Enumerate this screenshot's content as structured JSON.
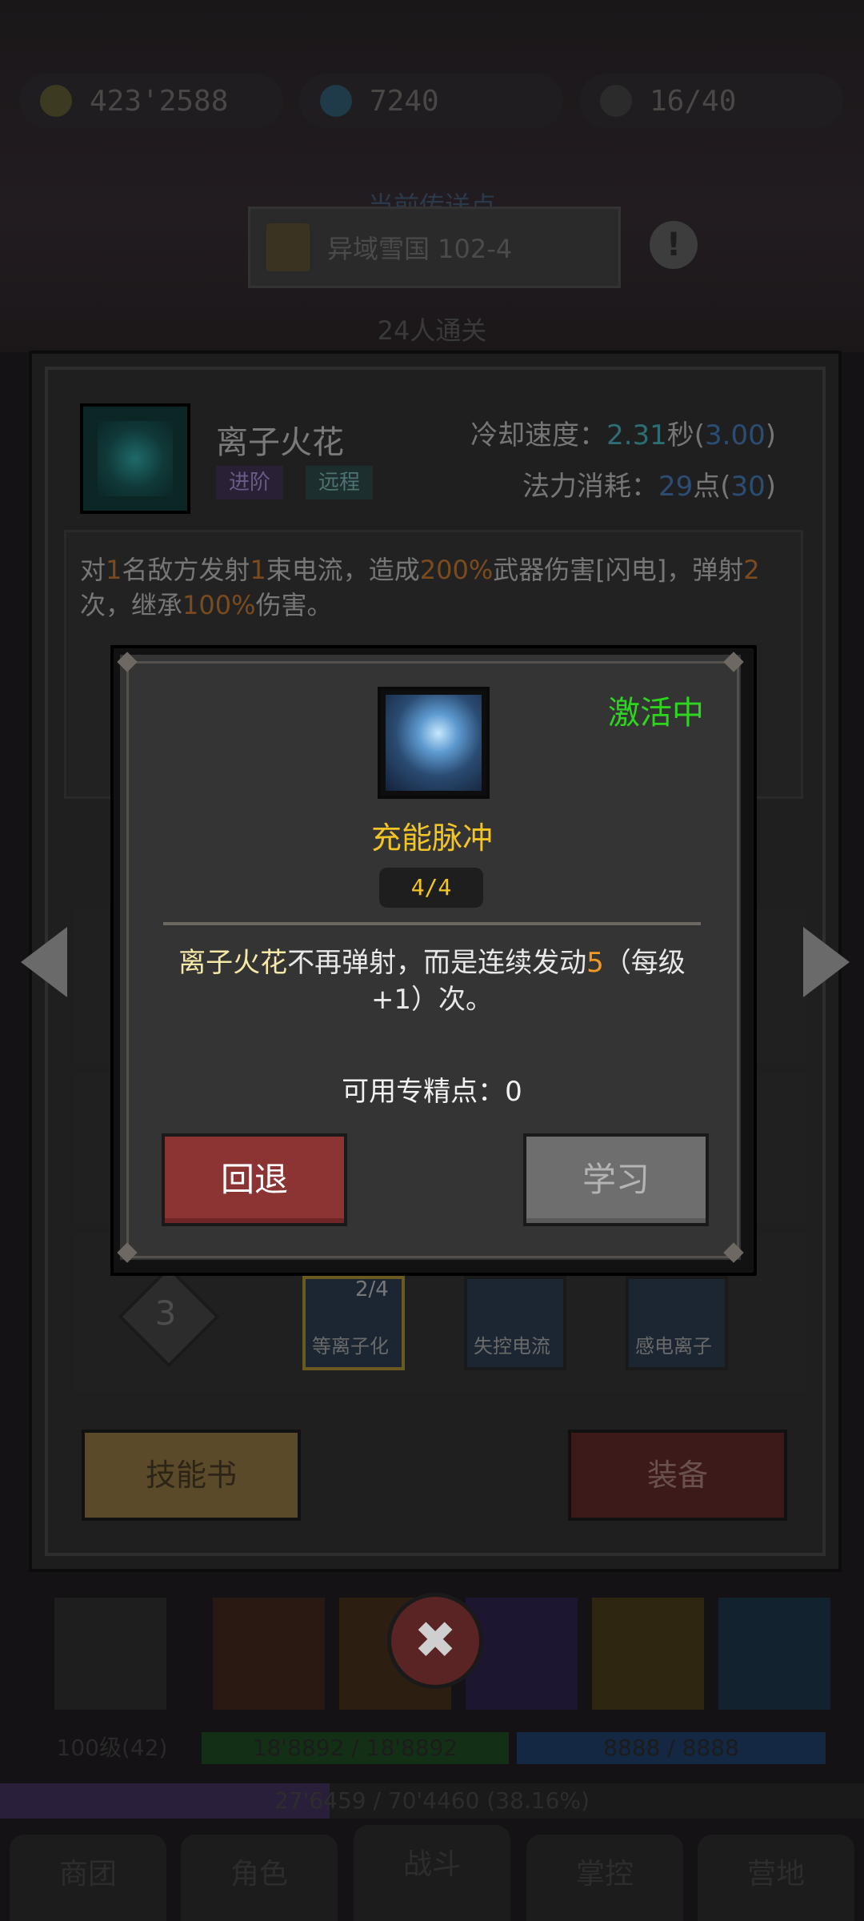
{
  "resources": {
    "gold": "423'2588",
    "gems": "7240",
    "keys": "16/40"
  },
  "portal": {
    "label": "当前传送点",
    "location": "异域雪国 102-4"
  },
  "cleared_label": "24人通关",
  "skill": {
    "name": "离子火花",
    "tags": [
      "进阶",
      "远程"
    ],
    "cooldown_label": "冷却速度：",
    "cooldown_value": "2.31",
    "cooldown_unit": "秒(",
    "cooldown_base": "3.00",
    "close_paren": ")",
    "mana_label": "法力消耗：",
    "mana_value": "29",
    "mana_unit": "点(",
    "mana_base": "30",
    "desc": {
      "p1": "对",
      "n1": "1",
      "p2": "名敌方发射",
      "n2": "1",
      "p3": "束电流，造成",
      "n3": "200%",
      "p4": "武器伤害[闪电]，弹射",
      "n4": "2",
      "p5": "次，继承",
      "n5": "100%",
      "p6": "伤害。"
    }
  },
  "talent_row": {
    "level": "3",
    "items": [
      {
        "name": "等离子化",
        "count": "2/4"
      },
      {
        "name": "失控电流"
      },
      {
        "name": "感电离子"
      }
    ]
  },
  "buttons": {
    "skill_book": "技能书",
    "equip": "装备"
  },
  "bottom": {
    "player_level": "100级(42)",
    "hp": "18'8892 / 18'8892",
    "mp": "8888 / 8888",
    "xp": "27'6459 / 70'4460 (38.16%)",
    "xp_fraction": 0.3816,
    "nav": [
      "商团",
      "角色",
      "战斗",
      "掌控",
      "营地"
    ]
  },
  "modal": {
    "status": "激活中",
    "talent_name": "充能脉冲",
    "level": "4/4",
    "desc_skill": "离子火花",
    "desc_mid": "不再弹射，而是连续发动",
    "desc_num": "5",
    "desc_end": "（每级+1）次。",
    "points": "可用专精点：0",
    "back_label": "回退",
    "learn_label": "学习"
  },
  "colors": {
    "status_green": "#2ed51e",
    "talent_gold": "#f2c424",
    "highlight_orange": "#f29a24",
    "back_red": "#8c3434",
    "learn_gray": "#6e6e6e"
  }
}
